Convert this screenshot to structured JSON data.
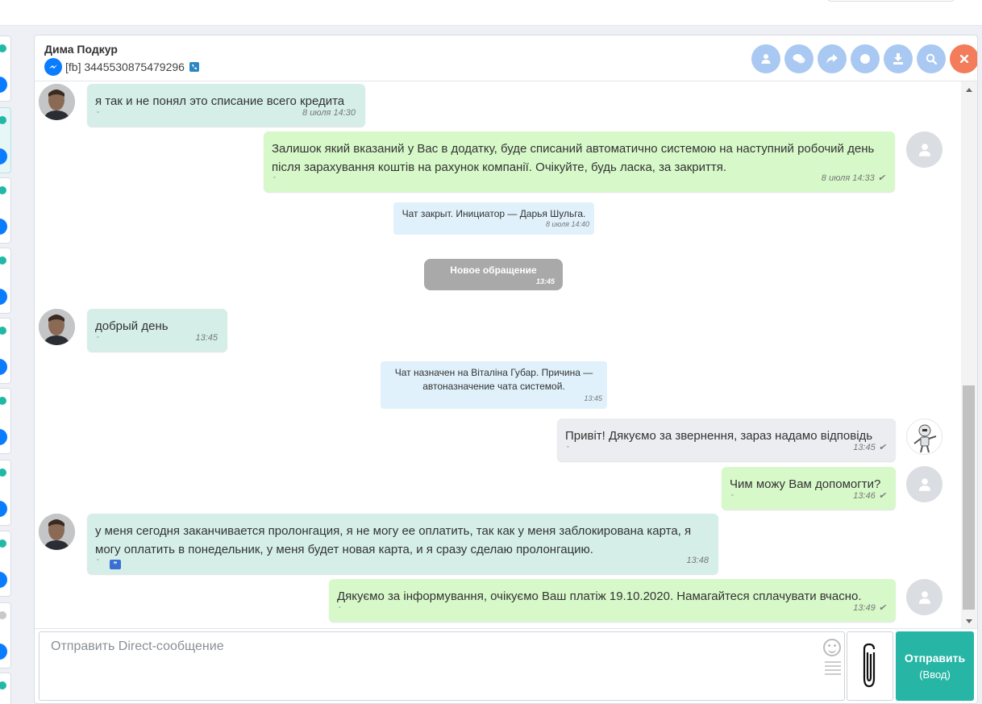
{
  "header": {
    "contact_name": "Дима Подкур",
    "contact_id": "[fb] 3445530875479296",
    "buttons": [
      {
        "name": "profile-button",
        "icon": "user-icon"
      },
      {
        "name": "chat-button",
        "icon": "comments-icon"
      },
      {
        "name": "forward-button",
        "icon": "share-icon"
      },
      {
        "name": "record-button",
        "icon": "circle-icon"
      },
      {
        "name": "download-button",
        "icon": "download-icon"
      },
      {
        "name": "search-button",
        "icon": "search-icon"
      },
      {
        "name": "close-button",
        "icon": "close-icon"
      }
    ]
  },
  "messages": [
    {
      "text": "я так и не понял это списание всего кредита",
      "time": "8 июля 14:30"
    },
    {
      "text": "Залишок який вказаний у Вас в додатку, буде списаний автоматично системою на наступний робочий день після зарахування коштів на рахунок компанії. Очікуйте, будь ласка, за закриття.",
      "time": "8 июля 14:33"
    },
    {
      "text": "Чат закрыт. Инициатор —  Дарья Шульга.",
      "time": "8 июля 14:40"
    },
    {
      "text": "Новое обращение",
      "time": "13:45"
    },
    {
      "text": "добрый день",
      "time": "13:45"
    },
    {
      "text": "Чат назначен на Віталіна Губар. Причина — автоназначение чата системой.",
      "time": "13:45"
    },
    {
      "text": "Привіт! Дякуємо за звернення, зараз надамо відповідь",
      "time": "13:45"
    },
    {
      "text": "Чим можу Вам допомогти?",
      "time": "13:46"
    },
    {
      "text": "у меня сегодня заканчивается пролонгация, я не могу ее оплатить, так как у меня заблокирована карта, я могу оплатить в понедельник, у меня будет новая карта, и я сразу сделаю пролонгацию.",
      "time": "13:48"
    },
    {
      "text": "Дякуємо за інформування, очікуємо Ваш платіж 19.10.2020. Намагайтеся сплачувати вчасно.",
      "time": "13:49"
    }
  ],
  "composer": {
    "placeholder": "Отправить Direct-сообщение",
    "send_label": "Отправить",
    "send_hint": "(Ввод)"
  },
  "colors": {
    "accent": "#27b6a5",
    "incoming_bubble": "#d5efe8",
    "outgoing_bubble": "#d7f9c9",
    "system_bubble": "#e0f1fb",
    "header_button": "#a9c9f2",
    "close_button": "#f37c5a"
  }
}
